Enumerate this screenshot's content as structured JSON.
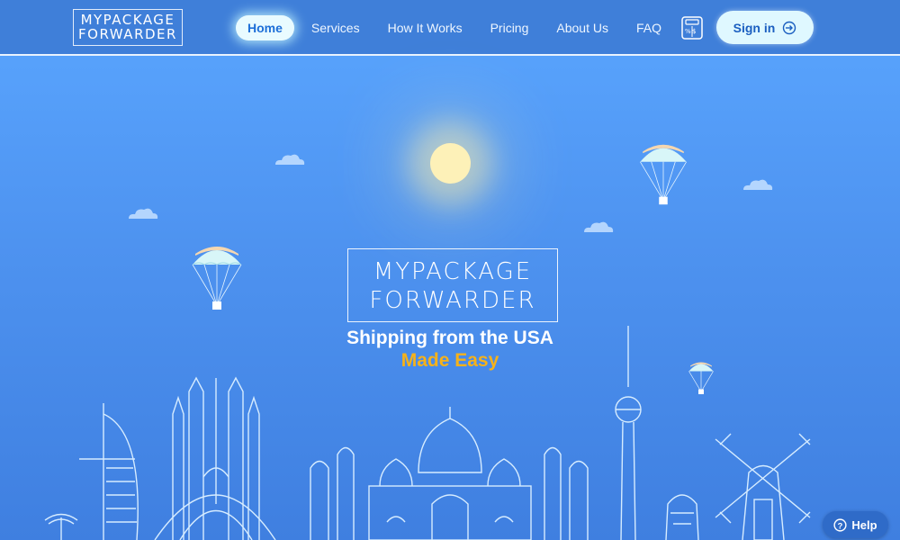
{
  "header": {
    "logo_line1": "MYPACKAGE",
    "logo_line2": "FORWARDER",
    "nav": [
      {
        "label": "Home",
        "active": true
      },
      {
        "label": "Services"
      },
      {
        "label": "How It Works"
      },
      {
        "label": "Pricing"
      },
      {
        "label": "About Us"
      },
      {
        "label": "FAQ"
      }
    ],
    "calculator_icon": "calculator-icon",
    "signin_label": "Sign in",
    "signin_icon": "sign-in-arrow-icon"
  },
  "hero": {
    "logo_line1": "MYPACKAGE",
    "logo_line2": "FORWARDER",
    "title": "Shipping from the USA",
    "subtitle": "Made Easy"
  },
  "help": {
    "label": "Help",
    "icon": "question-circle-icon"
  },
  "colors": {
    "sky_top": "#5aa6ff",
    "sky_bottom": "#3f7fe0",
    "header": "#3f7fd9",
    "accent_yellow": "#f6b21a",
    "button_bg": "#dff8ff"
  }
}
